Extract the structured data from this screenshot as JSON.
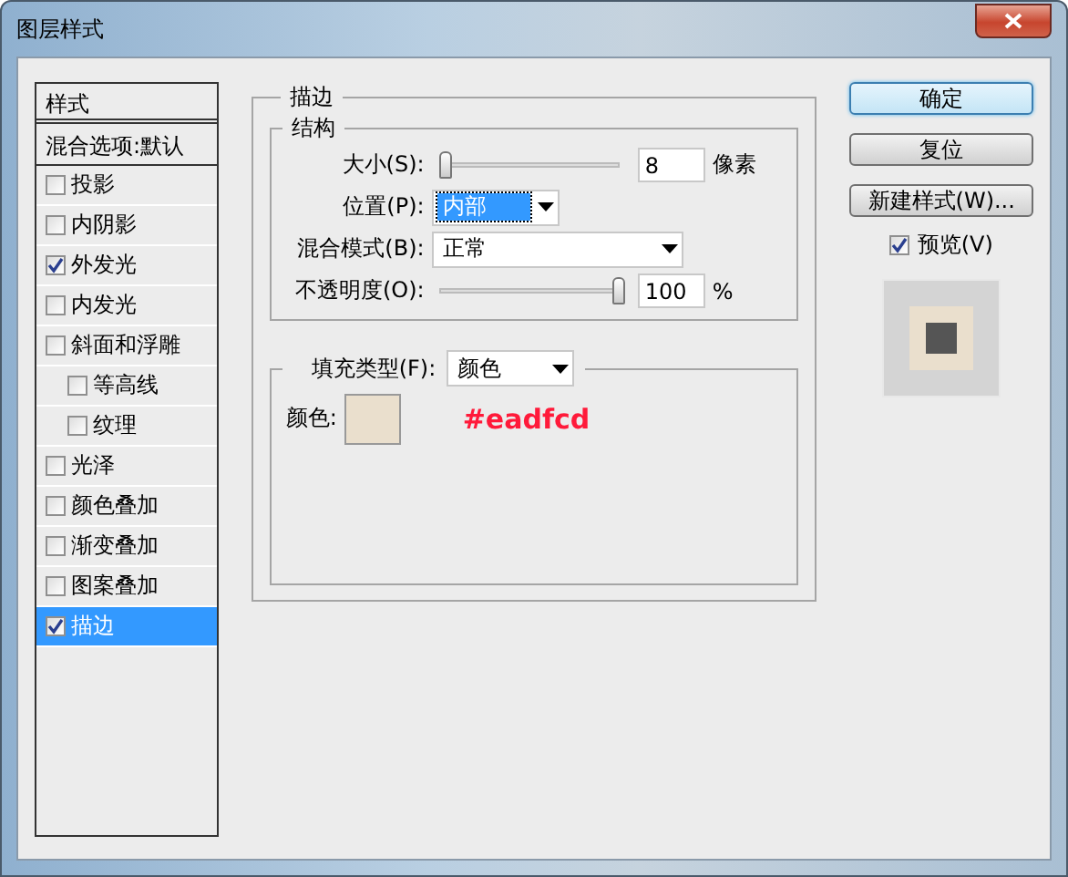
{
  "window": {
    "title": "图层样式"
  },
  "styles_panel": {
    "header": "样式",
    "blend_options": "混合选项:默认",
    "items": [
      {
        "label": "投影",
        "checked": false,
        "selected": false
      },
      {
        "label": "内阴影",
        "checked": false,
        "selected": false
      },
      {
        "label": "外发光",
        "checked": true,
        "selected": false
      },
      {
        "label": "内发光",
        "checked": false,
        "selected": false
      },
      {
        "label": "斜面和浮雕",
        "checked": false,
        "selected": false,
        "children": [
          {
            "label": "等高线",
            "checked": false,
            "selected": false
          },
          {
            "label": "纹理",
            "checked": false,
            "selected": false
          }
        ]
      },
      {
        "label": "光泽",
        "checked": false,
        "selected": false
      },
      {
        "label": "颜色叠加",
        "checked": false,
        "selected": false
      },
      {
        "label": "渐变叠加",
        "checked": false,
        "selected": false
      },
      {
        "label": "图案叠加",
        "checked": false,
        "selected": false
      },
      {
        "label": "描边",
        "checked": true,
        "selected": true
      }
    ]
  },
  "stroke": {
    "title": "描边",
    "structure": {
      "title": "结构",
      "size": {
        "label": "大小(S):",
        "level": 0.02,
        "value": "8",
        "unit": "像素"
      },
      "position": {
        "label": "位置(P):",
        "value": "内部",
        "focused": true
      },
      "blend_mode": {
        "label": "混合模式(B):",
        "value": "正常",
        "focused": false
      },
      "opacity": {
        "label": "不透明度(O):",
        "level": 1,
        "value": "100",
        "unit": "%"
      }
    },
    "fill": {
      "type_label": "填充类型(F):",
      "type_value": "颜色",
      "color_label": "颜色:",
      "color": "#eadfcd",
      "annotation": "#eadfcd"
    }
  },
  "buttons": [
    {
      "label": "确定",
      "default": true
    },
    {
      "label": "复位",
      "default": false
    },
    {
      "label": "新建样式(W)...",
      "default": false
    }
  ],
  "preview": {
    "label": "预览(V)",
    "checked": true
  }
}
